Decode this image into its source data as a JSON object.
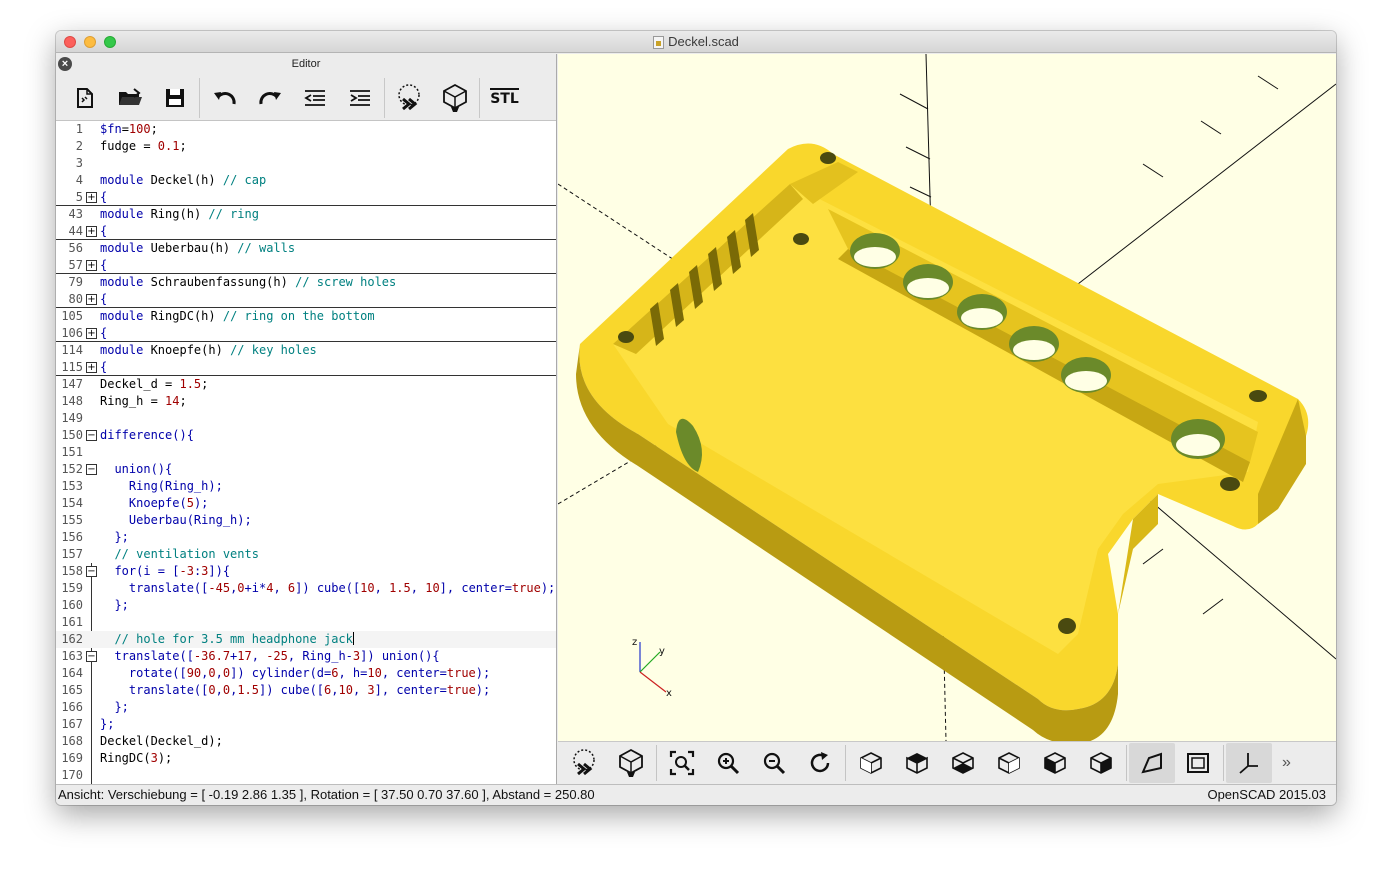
{
  "window": {
    "title": "Deckel.scad"
  },
  "editor": {
    "title": "Editor",
    "toolbar": [
      "new-file",
      "open-file",
      "save-file",
      "undo",
      "redo",
      "unindent",
      "indent",
      "preview",
      "render",
      "export-stl"
    ],
    "stl_label": "STL",
    "lines": [
      {
        "no": "1"
      },
      {
        "no": "2"
      },
      {
        "no": "3"
      },
      {
        "no": "4"
      },
      {
        "no": "5"
      },
      {
        "no": "43"
      },
      {
        "no": "44"
      },
      {
        "no": "56"
      },
      {
        "no": "57"
      },
      {
        "no": "79"
      },
      {
        "no": "80"
      },
      {
        "no": "105"
      },
      {
        "no": "106"
      },
      {
        "no": "114"
      },
      {
        "no": "115"
      },
      {
        "no": "147"
      },
      {
        "no": "148"
      },
      {
        "no": "149"
      },
      {
        "no": "150"
      },
      {
        "no": "151"
      },
      {
        "no": "152"
      },
      {
        "no": "153"
      },
      {
        "no": "154"
      },
      {
        "no": "155"
      },
      {
        "no": "156"
      },
      {
        "no": "157"
      },
      {
        "no": "158"
      },
      {
        "no": "159"
      },
      {
        "no": "160"
      },
      {
        "no": "161"
      },
      {
        "no": "162"
      },
      {
        "no": "163"
      },
      {
        "no": "164"
      },
      {
        "no": "165"
      },
      {
        "no": "166"
      },
      {
        "no": "167"
      },
      {
        "no": "168"
      },
      {
        "no": "169"
      },
      {
        "no": "170"
      }
    ]
  },
  "code": {
    "l1a": "$fn",
    "l1b": "=",
    "l1c": "100",
    "l1d": ";",
    "l2a": "fudge = ",
    "l2b": "0.1",
    "l2c": ";",
    "l4a": "module ",
    "l4b": "Deckel",
    "l4c": "(",
    "l4d": "h",
    "l4e": ") ",
    "l4f": "// cap",
    "l5": "{",
    "l43a": "module ",
    "l43b": "Ring",
    "l43c": "(",
    "l43d": "h",
    "l43e": ") ",
    "l43f": "// ring",
    "l44": "{",
    "l56a": "module ",
    "l56b": "Ueberbau",
    "l56c": "(",
    "l56d": "h",
    "l56e": ") ",
    "l56f": "// walls",
    "l57": "{",
    "l79a": "module ",
    "l79b": "Schraubenfassung",
    "l79c": "(",
    "l79d": "h",
    "l79e": ") ",
    "l79f": "// screw holes",
    "l80": "{",
    "l105a": "module ",
    "l105b": "RingDC",
    "l105c": "(",
    "l105d": "h",
    "l105e": ") ",
    "l105f": "// ring on the bottom",
    "l106": "{",
    "l114a": "module ",
    "l114b": "Knoepfe",
    "l114c": "(",
    "l114d": "h",
    "l114e": ") ",
    "l114f": "// key holes",
    "l115": "{",
    "l147a": "Deckel_d",
    "l147b": " = ",
    "l147c": "1.5",
    "l147d": ";",
    "l148a": "Ring_h",
    "l148b": " = ",
    "l148c": "14",
    "l148d": ";",
    "l150": "difference(){",
    "l152": "  union(){",
    "l153a": "    Ring(Ring_h);",
    "l154a": "    Knoepfe(",
    "l154b": "5",
    "l154c": ");",
    "l155": "    Ueberbau(Ring_h);",
    "l156": "  };",
    "l157": "  // ventilation vents",
    "l158a": "  for(i = [",
    "l158b": "-3",
    "l158c": ":",
    "l158d": "3",
    "l158e": "]){",
    "l159a": "    translate([",
    "l159b": "-45",
    "l159c": ",",
    "l159d": "0",
    "l159e": "+i*",
    "l159f": "4",
    "l159g": ", ",
    "l159h": "6",
    "l159i": "]) cube([",
    "l159j": "10",
    "l159k": ", ",
    "l159l": "1.5",
    "l159m": ", ",
    "l159n": "10",
    "l159o": "], center=",
    "l159p": "true",
    "l159q": ");",
    "l160": "  };",
    "l162": "  // hole for 3.5 mm headphone jack",
    "l163a": "  translate([",
    "l163b": "-36.7",
    "l163c": "+",
    "l163d": "17",
    "l163e": ", ",
    "l163f": "-25",
    "l163g": ", Ring_h-",
    "l163h": "3",
    "l163i": "]) union(){",
    "l164a": "    rotate([",
    "l164b": "90",
    "l164c": ",",
    "l164d": "0",
    "l164e": ",",
    "l164f": "0",
    "l164g": "]) cylinder(d=",
    "l164h": "6",
    "l164i": ", h=",
    "l164j": "10",
    "l164k": ", center=",
    "l164l": "true",
    "l164m": ");",
    "l165a": "    translate([",
    "l165b": "0",
    "l165c": ",",
    "l165d": "0",
    "l165e": ",",
    "l165f": "1.5",
    "l165g": "]) cube([",
    "l165h": "6",
    "l165i": ",",
    "l165j": "10",
    "l165k": ", ",
    "l165l": "3",
    "l165m": "], center=",
    "l165n": "true",
    "l165o": ");",
    "l166": "  };",
    "l167": "};",
    "l168": "Deckel(Deckel_d);",
    "l169a": "RingDC(",
    "l169b": "3",
    "l169c": ");"
  },
  "viewport": {
    "axis_x": "x",
    "axis_y": "y",
    "axis_z": "z",
    "model_color": "#f9d72c",
    "background": "#ffffe5",
    "toolbar": [
      "preview",
      "render",
      "view-all",
      "zoom-in",
      "zoom-out",
      "reset-view",
      "view-right",
      "view-top",
      "view-bottom",
      "view-left",
      "view-front",
      "view-back",
      "perspective",
      "orthogonal",
      "show-axes"
    ],
    "more": "»"
  },
  "status": {
    "left": "Ansicht: Verschiebung = [ -0.19 2.86 1.35 ], Rotation = [ 37.50 0.70 37.60 ], Abstand = 250.80",
    "right": "OpenSCAD 2015.03"
  }
}
